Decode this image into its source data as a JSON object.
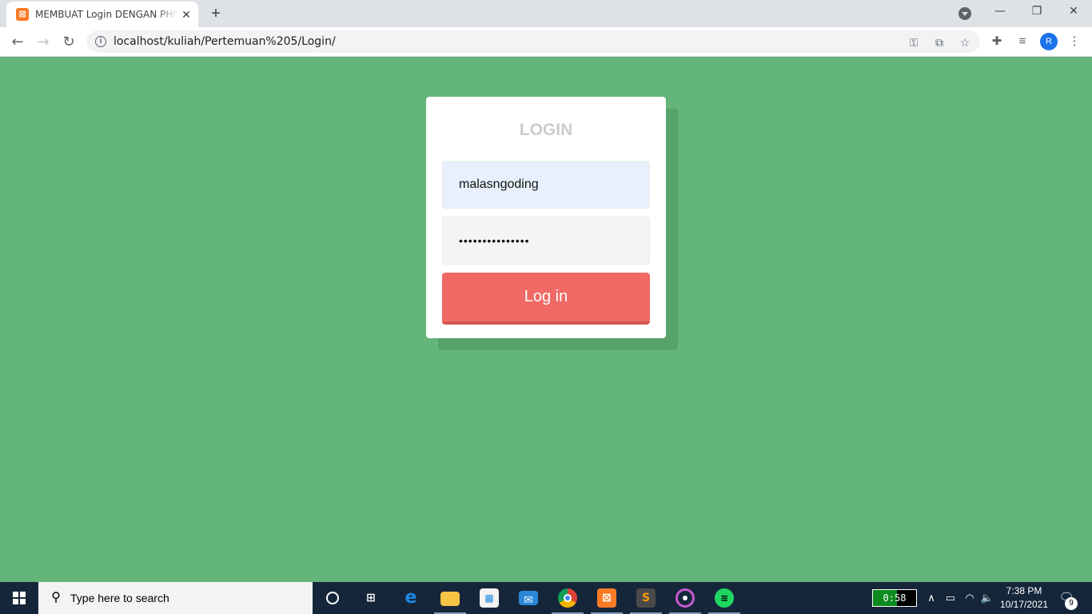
{
  "browser": {
    "tab_title": "MEMBUAT Login DENGAN PHP DAN MYSQLI",
    "tab_favicon_glyph": "⊠",
    "tab_close_glyph": "✕",
    "new_tab_glyph": "+",
    "url": "localhost/kuliah/Pertemuan%205/Login/",
    "profile_initial": "R",
    "window_controls": {
      "minimize": "—",
      "restore": "❐",
      "close": "✕"
    },
    "nav": {
      "back": "←",
      "forward": "→",
      "reload": "↻"
    }
  },
  "login": {
    "title": "LOGIN",
    "username_value": "malasngoding",
    "password_masked": "•••••••••••••••",
    "submit_label": "Log in"
  },
  "taskbar": {
    "search_placeholder": "Type here to search",
    "battery_timer": "0:58",
    "time": "7:38 PM",
    "date": "10/17/2021",
    "notification_count": "9"
  },
  "colors": {
    "page_background": "#64b579",
    "login_button": "#f06964",
    "title_text": "#cccccc",
    "username_field": "#e8f0fe",
    "password_field": "#f4f4f4"
  }
}
